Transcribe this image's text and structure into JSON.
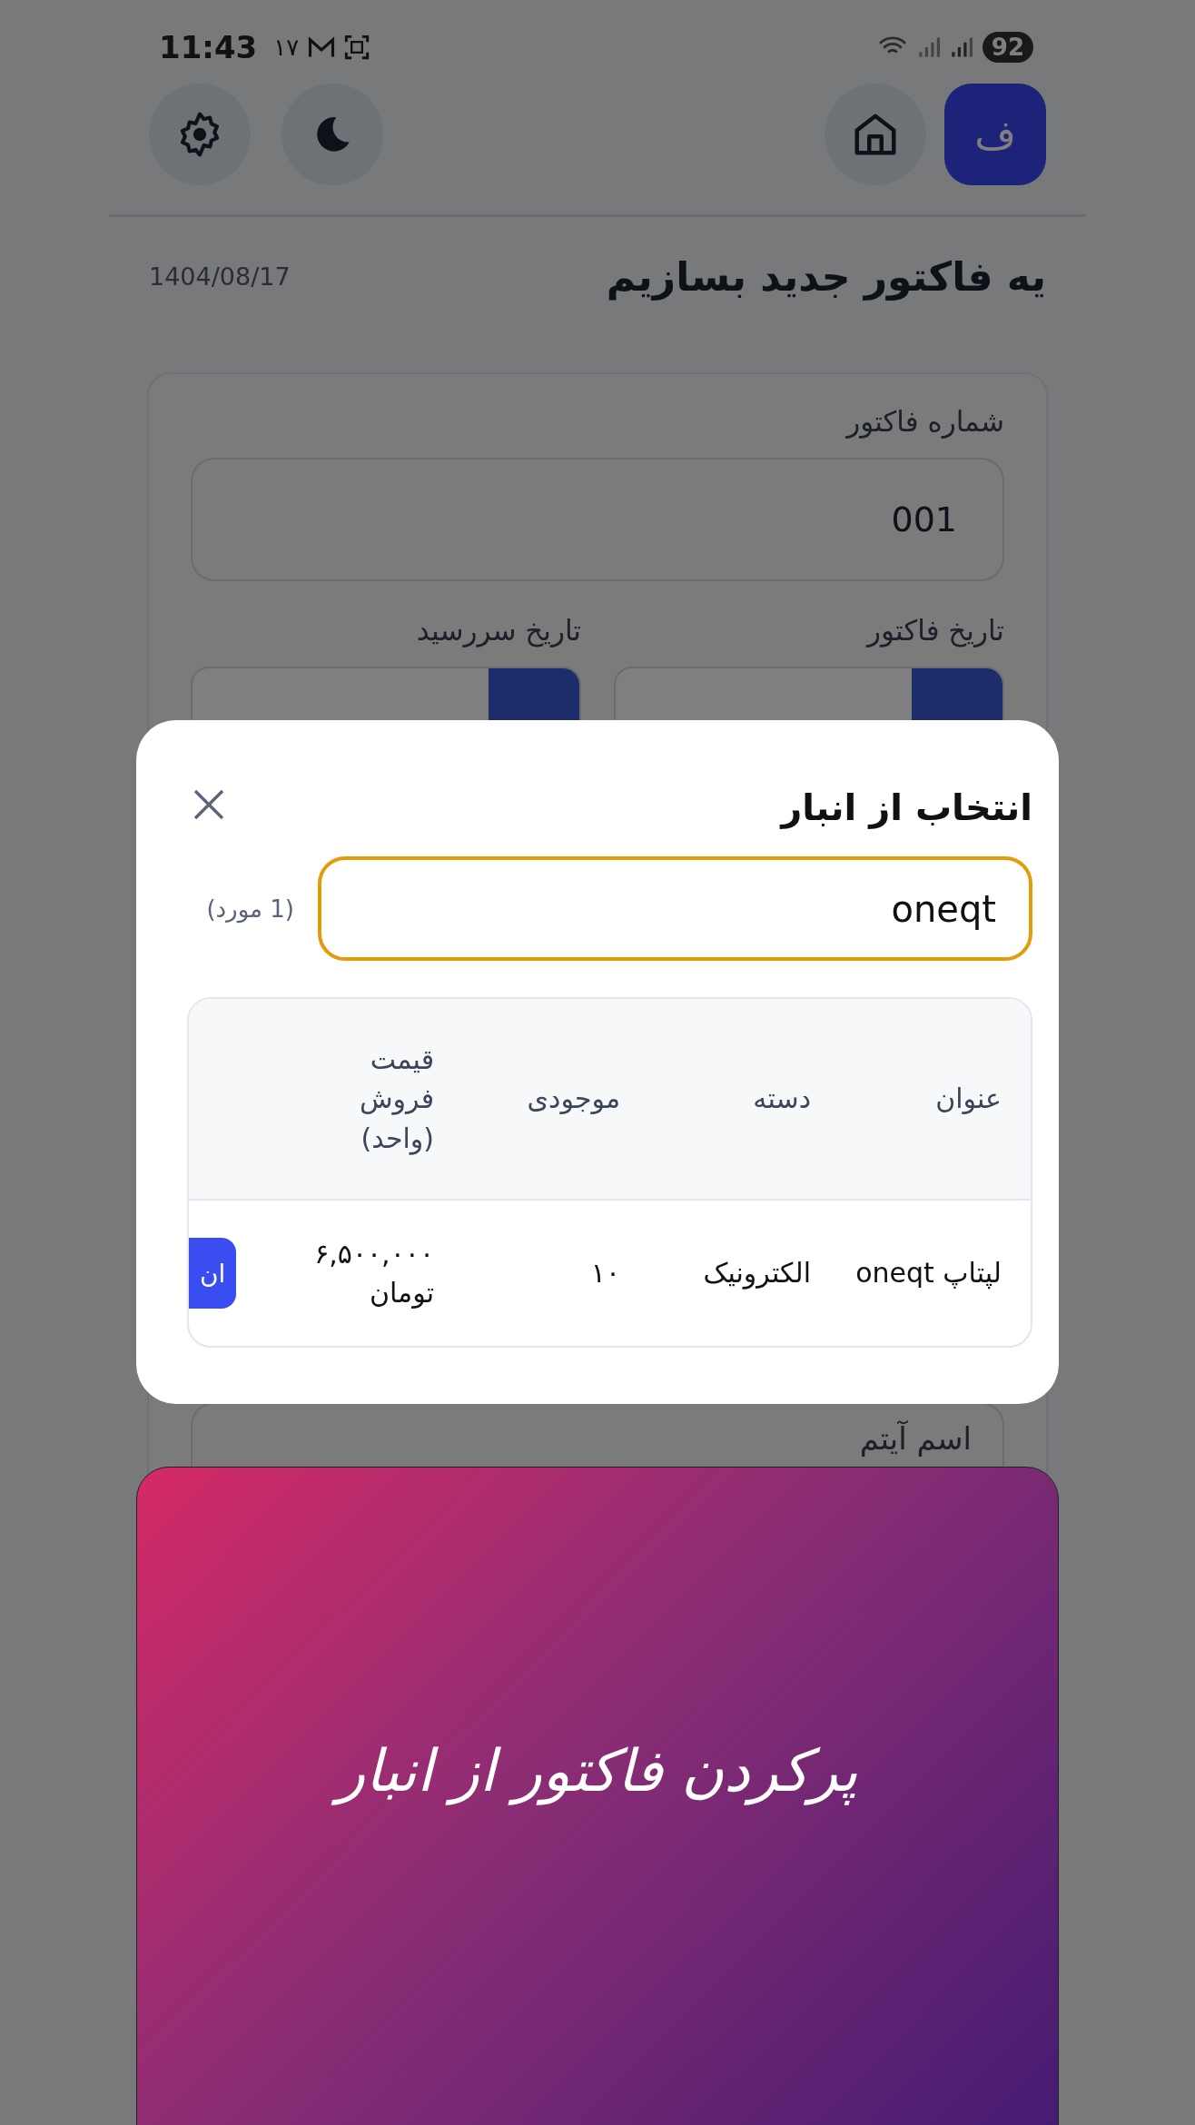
{
  "status_bar": {
    "time": "11:43",
    "date": "۱۷",
    "battery": "92"
  },
  "header": {
    "avatar_letter": "ف"
  },
  "page": {
    "title": "یه فاکتور جدید بسازیم",
    "date": "1404/08/17"
  },
  "form": {
    "invoice_number": {
      "label": "شماره فاکتور",
      "value": "001"
    },
    "invoice_date": {
      "label": "تاریخ فاکتور"
    },
    "due_date": {
      "label": "تاریخ سررسید"
    },
    "item_name": {
      "label": "اسم آیتم"
    }
  },
  "dialog": {
    "title": "انتخاب از انبار",
    "search": {
      "value": "oneqt"
    },
    "count": "(1 مورد)",
    "table": {
      "columns": [
        "عنوان",
        "دسته",
        "موجودی",
        "قیمت فروش (واحد)"
      ],
      "rows": [
        {
          "cells": [
            "لپتاپ oneqt",
            "الکترونیک",
            "۱۰",
            "۶,۵۰۰,۰۰۰ تومان"
          ],
          "action": "ان"
        }
      ]
    }
  },
  "banner": {
    "text": "پرکردن فاکتور از انبار"
  }
}
